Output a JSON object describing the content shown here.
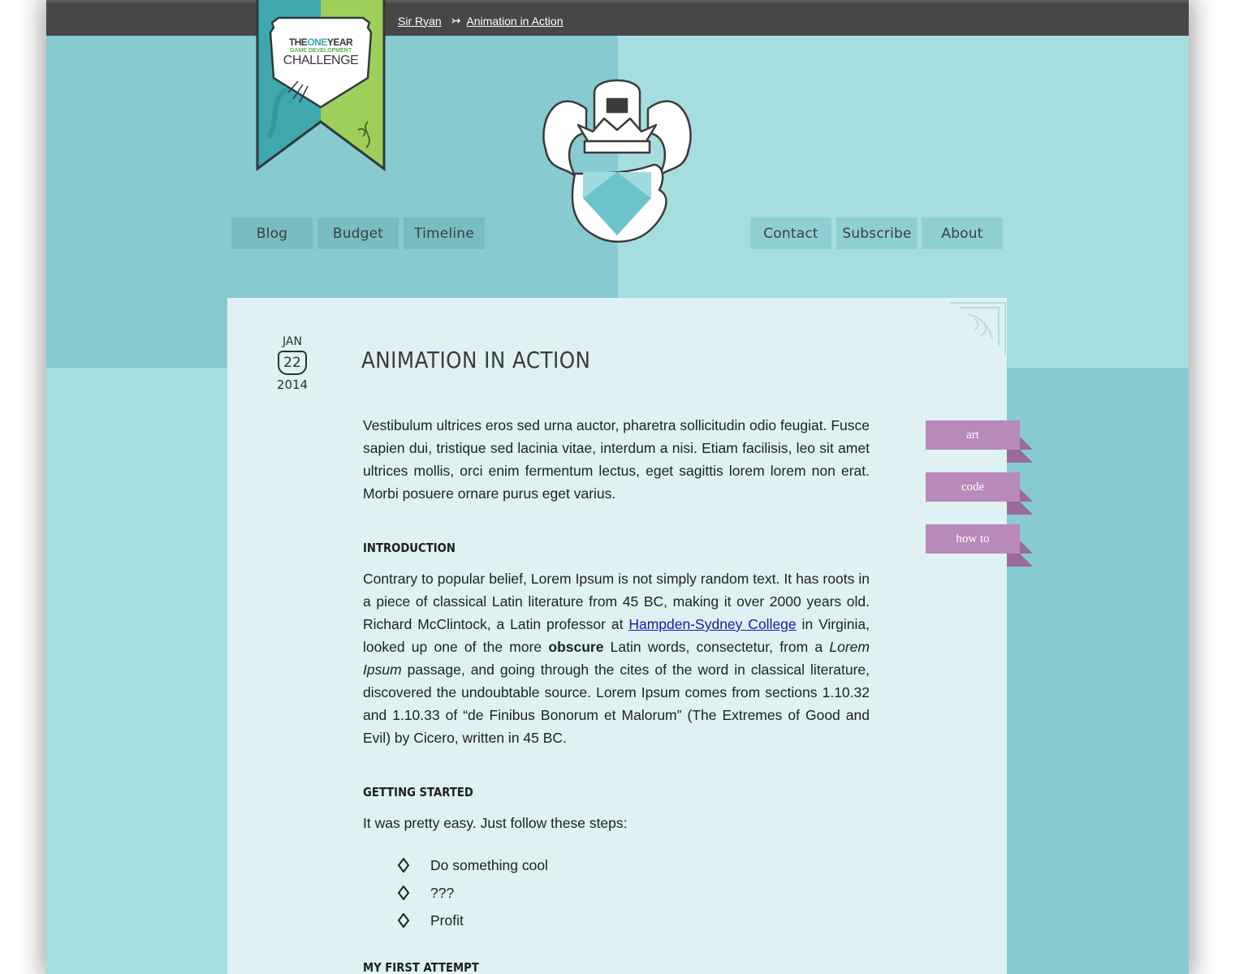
{
  "breadcrumb": {
    "home": "Sir Ryan",
    "separator": "↣",
    "current": "Animation in Action"
  },
  "badge": {
    "line1_a": "THE",
    "line1_b": "ONE",
    "line1_c": "YEAR",
    "line2": "GAME DEVELOPMENT",
    "line3": "CHALLENGE"
  },
  "nav_left": [
    {
      "label": "Blog"
    },
    {
      "label": "Budget"
    },
    {
      "label": "Timeline"
    }
  ],
  "nav_right": [
    {
      "label": "Contact"
    },
    {
      "label": "Subscribe"
    },
    {
      "label": "About"
    }
  ],
  "post": {
    "date": {
      "month": "Jan",
      "day": "22",
      "year": "2014"
    },
    "title": "Animation in Action",
    "intro_paragraph": "Vestibulum ultrices eros sed urna auctor, pharetra sollicitudin odio feugiat. Fusce sapien dui, tristique sed lacinia vitae, interdum a nisi. Etiam facilisis, leo sit amet ultrices mollis, orci enim fermentum lectus, eget sagittis lorem lorem non erat. Morbi posuere ornare purus eget varius.",
    "section_intro_heading": "Introduction",
    "section_intro": {
      "t1": "Contrary to popular belief, Lorem Ipsum is not simply random text. It has roots in a piece of classical Latin literature from 45 BC, making it over 2000 years old. Richard McClintock, a Latin professor at ",
      "link": "Hampden-Sydney College",
      "t2": " in Virginia, looked up one of the more ",
      "bold": "obscure",
      "t3": " Latin words, consectetur, from a ",
      "italic": "Lorem Ipsum",
      "t4": " passage, and going through the cites of the word in classical literature, discovered the undoubtable source. Lorem Ipsum comes from sections 1.10.32 and 1.10.33 of “de Finibus Bonorum et Malorum” (The Extremes of Good and Evil) by Cicero, written in 45 BC."
    },
    "section_start_heading": "Getting Started",
    "section_start_text": "It was pretty easy. Just follow these steps:",
    "steps": [
      "Do something cool",
      "???",
      "Profit"
    ],
    "section_first_heading": "My First Attempt"
  },
  "tags": [
    {
      "label": "art"
    },
    {
      "label": "code"
    },
    {
      "label": "how to"
    }
  ],
  "colors": {
    "topbar": "#474747",
    "background_light": "#a6dedf",
    "background_dark": "#87cacf",
    "content": "#dff1f3",
    "tag": "#b889b9",
    "tag_fold": "#9a6a9c",
    "link": "#1a1aa6"
  }
}
